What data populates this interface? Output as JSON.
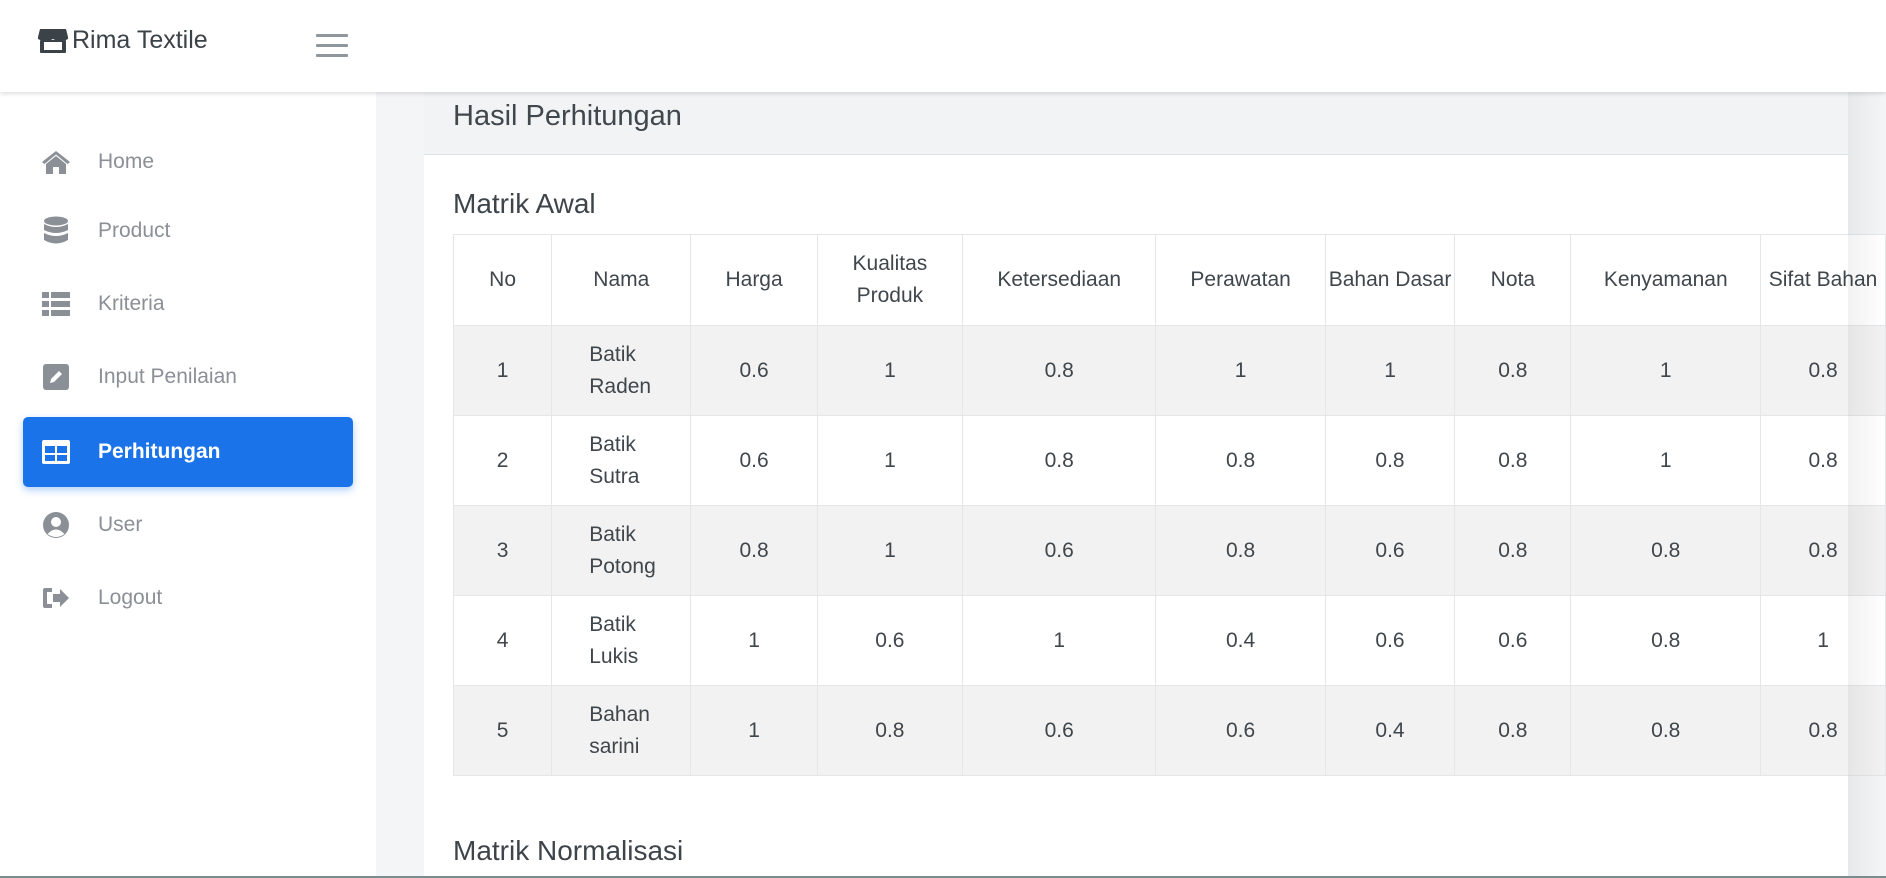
{
  "app": {
    "brand": "Rima Textile"
  },
  "sidebar": {
    "items": [
      {
        "label": "Home",
        "icon": "home-icon"
      },
      {
        "label": "Product",
        "icon": "database-icon"
      },
      {
        "label": "Kriteria",
        "icon": "list-icon"
      },
      {
        "label": "Input Penilaian",
        "icon": "edit-icon"
      },
      {
        "label": "Perhitungan",
        "icon": "table-icon",
        "active": true
      },
      {
        "label": "User",
        "icon": "user-circle-icon"
      },
      {
        "label": "Logout",
        "icon": "logout-icon"
      }
    ]
  },
  "main": {
    "card_title": "Hasil Perhitungan",
    "section1_title": "Matrik Awal",
    "section2_title": "Matrik Normalisasi",
    "table": {
      "headers": [
        "No",
        "Nama",
        "Harga",
        "Kualitas Produk",
        "Ketersediaan",
        "Perawatan",
        "Bahan Dasar",
        "Nota",
        "Kenyamanan",
        "Sifat Bahan"
      ],
      "rows": [
        [
          "1",
          "Batik Raden",
          "0.6",
          "1",
          "0.8",
          "1",
          "1",
          "0.8",
          "1",
          "0.8"
        ],
        [
          "2",
          "Batik Sutra",
          "0.6",
          "1",
          "0.8",
          "0.8",
          "0.8",
          "0.8",
          "1",
          "0.8"
        ],
        [
          "3",
          "Batik Potong",
          "0.8",
          "1",
          "0.6",
          "0.8",
          "0.6",
          "0.8",
          "0.8",
          "0.8"
        ],
        [
          "4",
          "Batik Lukis",
          "1",
          "0.6",
          "1",
          "0.4",
          "0.6",
          "0.6",
          "0.8",
          "1"
        ],
        [
          "5",
          "Bahan sarini",
          "1",
          "0.8",
          "0.6",
          "0.6",
          "0.4",
          "0.8",
          "0.8",
          "0.8"
        ]
      ]
    }
  },
  "colors": {
    "accent": "#1a73e8",
    "nav_text": "#8a9096",
    "stripe": "#f2f2f2"
  }
}
